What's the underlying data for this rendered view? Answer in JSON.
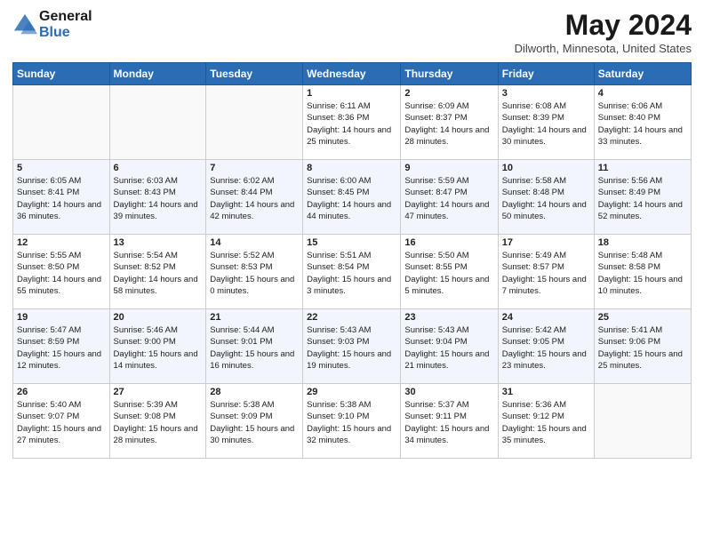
{
  "header": {
    "logo_line1": "General",
    "logo_line2": "Blue",
    "month": "May 2024",
    "location": "Dilworth, Minnesota, United States"
  },
  "weekdays": [
    "Sunday",
    "Monday",
    "Tuesday",
    "Wednesday",
    "Thursday",
    "Friday",
    "Saturday"
  ],
  "weeks": [
    [
      {
        "day": "",
        "sunrise": "",
        "sunset": "",
        "daylight": ""
      },
      {
        "day": "",
        "sunrise": "",
        "sunset": "",
        "daylight": ""
      },
      {
        "day": "",
        "sunrise": "",
        "sunset": "",
        "daylight": ""
      },
      {
        "day": "1",
        "sunrise": "Sunrise: 6:11 AM",
        "sunset": "Sunset: 8:36 PM",
        "daylight": "Daylight: 14 hours and 25 minutes."
      },
      {
        "day": "2",
        "sunrise": "Sunrise: 6:09 AM",
        "sunset": "Sunset: 8:37 PM",
        "daylight": "Daylight: 14 hours and 28 minutes."
      },
      {
        "day": "3",
        "sunrise": "Sunrise: 6:08 AM",
        "sunset": "Sunset: 8:39 PM",
        "daylight": "Daylight: 14 hours and 30 minutes."
      },
      {
        "day": "4",
        "sunrise": "Sunrise: 6:06 AM",
        "sunset": "Sunset: 8:40 PM",
        "daylight": "Daylight: 14 hours and 33 minutes."
      }
    ],
    [
      {
        "day": "5",
        "sunrise": "Sunrise: 6:05 AM",
        "sunset": "Sunset: 8:41 PM",
        "daylight": "Daylight: 14 hours and 36 minutes."
      },
      {
        "day": "6",
        "sunrise": "Sunrise: 6:03 AM",
        "sunset": "Sunset: 8:43 PM",
        "daylight": "Daylight: 14 hours and 39 minutes."
      },
      {
        "day": "7",
        "sunrise": "Sunrise: 6:02 AM",
        "sunset": "Sunset: 8:44 PM",
        "daylight": "Daylight: 14 hours and 42 minutes."
      },
      {
        "day": "8",
        "sunrise": "Sunrise: 6:00 AM",
        "sunset": "Sunset: 8:45 PM",
        "daylight": "Daylight: 14 hours and 44 minutes."
      },
      {
        "day": "9",
        "sunrise": "Sunrise: 5:59 AM",
        "sunset": "Sunset: 8:47 PM",
        "daylight": "Daylight: 14 hours and 47 minutes."
      },
      {
        "day": "10",
        "sunrise": "Sunrise: 5:58 AM",
        "sunset": "Sunset: 8:48 PM",
        "daylight": "Daylight: 14 hours and 50 minutes."
      },
      {
        "day": "11",
        "sunrise": "Sunrise: 5:56 AM",
        "sunset": "Sunset: 8:49 PM",
        "daylight": "Daylight: 14 hours and 52 minutes."
      }
    ],
    [
      {
        "day": "12",
        "sunrise": "Sunrise: 5:55 AM",
        "sunset": "Sunset: 8:50 PM",
        "daylight": "Daylight: 14 hours and 55 minutes."
      },
      {
        "day": "13",
        "sunrise": "Sunrise: 5:54 AM",
        "sunset": "Sunset: 8:52 PM",
        "daylight": "Daylight: 14 hours and 58 minutes."
      },
      {
        "day": "14",
        "sunrise": "Sunrise: 5:52 AM",
        "sunset": "Sunset: 8:53 PM",
        "daylight": "Daylight: 15 hours and 0 minutes."
      },
      {
        "day": "15",
        "sunrise": "Sunrise: 5:51 AM",
        "sunset": "Sunset: 8:54 PM",
        "daylight": "Daylight: 15 hours and 3 minutes."
      },
      {
        "day": "16",
        "sunrise": "Sunrise: 5:50 AM",
        "sunset": "Sunset: 8:55 PM",
        "daylight": "Daylight: 15 hours and 5 minutes."
      },
      {
        "day": "17",
        "sunrise": "Sunrise: 5:49 AM",
        "sunset": "Sunset: 8:57 PM",
        "daylight": "Daylight: 15 hours and 7 minutes."
      },
      {
        "day": "18",
        "sunrise": "Sunrise: 5:48 AM",
        "sunset": "Sunset: 8:58 PM",
        "daylight": "Daylight: 15 hours and 10 minutes."
      }
    ],
    [
      {
        "day": "19",
        "sunrise": "Sunrise: 5:47 AM",
        "sunset": "Sunset: 8:59 PM",
        "daylight": "Daylight: 15 hours and 12 minutes."
      },
      {
        "day": "20",
        "sunrise": "Sunrise: 5:46 AM",
        "sunset": "Sunset: 9:00 PM",
        "daylight": "Daylight: 15 hours and 14 minutes."
      },
      {
        "day": "21",
        "sunrise": "Sunrise: 5:44 AM",
        "sunset": "Sunset: 9:01 PM",
        "daylight": "Daylight: 15 hours and 16 minutes."
      },
      {
        "day": "22",
        "sunrise": "Sunrise: 5:43 AM",
        "sunset": "Sunset: 9:03 PM",
        "daylight": "Daylight: 15 hours and 19 minutes."
      },
      {
        "day": "23",
        "sunrise": "Sunrise: 5:43 AM",
        "sunset": "Sunset: 9:04 PM",
        "daylight": "Daylight: 15 hours and 21 minutes."
      },
      {
        "day": "24",
        "sunrise": "Sunrise: 5:42 AM",
        "sunset": "Sunset: 9:05 PM",
        "daylight": "Daylight: 15 hours and 23 minutes."
      },
      {
        "day": "25",
        "sunrise": "Sunrise: 5:41 AM",
        "sunset": "Sunset: 9:06 PM",
        "daylight": "Daylight: 15 hours and 25 minutes."
      }
    ],
    [
      {
        "day": "26",
        "sunrise": "Sunrise: 5:40 AM",
        "sunset": "Sunset: 9:07 PM",
        "daylight": "Daylight: 15 hours and 27 minutes."
      },
      {
        "day": "27",
        "sunrise": "Sunrise: 5:39 AM",
        "sunset": "Sunset: 9:08 PM",
        "daylight": "Daylight: 15 hours and 28 minutes."
      },
      {
        "day": "28",
        "sunrise": "Sunrise: 5:38 AM",
        "sunset": "Sunset: 9:09 PM",
        "daylight": "Daylight: 15 hours and 30 minutes."
      },
      {
        "day": "29",
        "sunrise": "Sunrise: 5:38 AM",
        "sunset": "Sunset: 9:10 PM",
        "daylight": "Daylight: 15 hours and 32 minutes."
      },
      {
        "day": "30",
        "sunrise": "Sunrise: 5:37 AM",
        "sunset": "Sunset: 9:11 PM",
        "daylight": "Daylight: 15 hours and 34 minutes."
      },
      {
        "day": "31",
        "sunrise": "Sunrise: 5:36 AM",
        "sunset": "Sunset: 9:12 PM",
        "daylight": "Daylight: 15 hours and 35 minutes."
      },
      {
        "day": "",
        "sunrise": "",
        "sunset": "",
        "daylight": ""
      }
    ]
  ]
}
